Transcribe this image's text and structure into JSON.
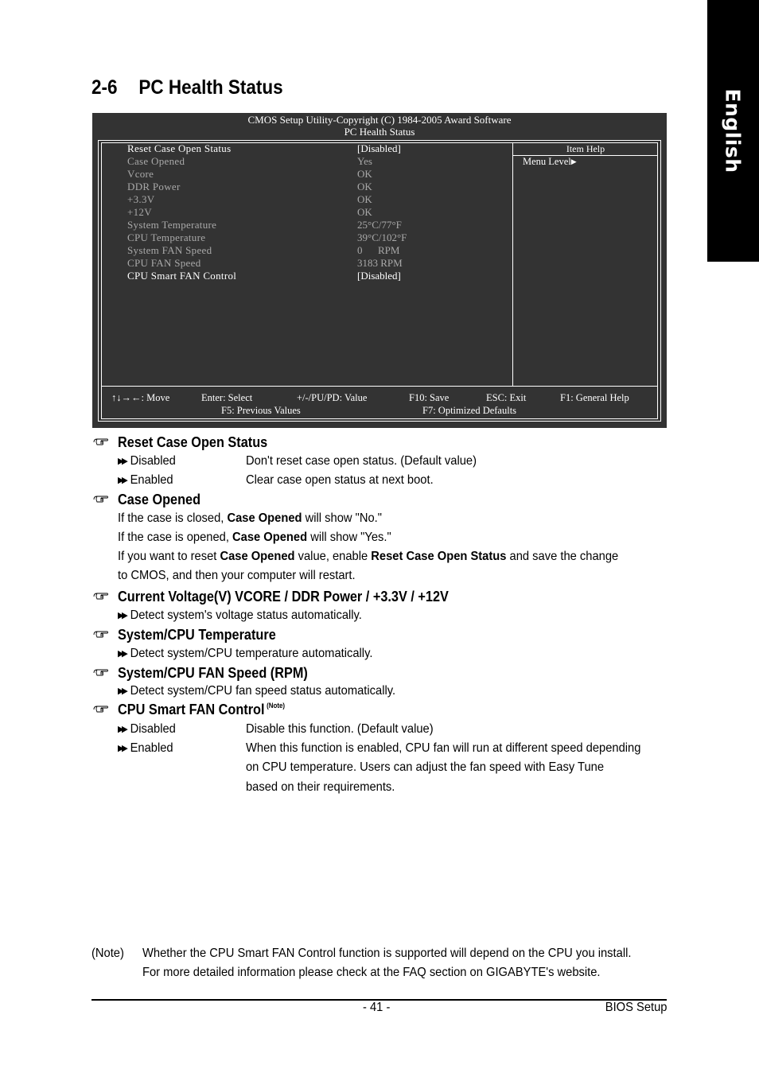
{
  "side_tab": {
    "label": "English"
  },
  "page": {
    "section_number": "2-6",
    "title": "PC Health Status"
  },
  "bios": {
    "header_line1": "CMOS Setup Utility-Copyright (C) 1984-2005 Award Software",
    "header_line2": "PC Health Status",
    "rows": [
      {
        "label": "Reset Case Open Status",
        "value": "[Disabled]",
        "state": "active"
      },
      {
        "label": "Case Opened",
        "value": "Yes",
        "state": "dim"
      },
      {
        "label": "Vcore",
        "value": "OK",
        "state": "dim"
      },
      {
        "label": "DDR Power",
        "value": "OK",
        "state": "dim"
      },
      {
        "label": "+3.3V",
        "value": "OK",
        "state": "dim"
      },
      {
        "label": "+12V",
        "value": "OK",
        "state": "dim"
      },
      {
        "label": "System Temperature",
        "value": "25°C/77°F",
        "state": "dim"
      },
      {
        "label": "CPU Temperature",
        "value": "39°C/102°F",
        "state": "dim"
      },
      {
        "label": "System FAN Speed",
        "value": "0      RPM",
        "state": "dim"
      },
      {
        "label": "CPU FAN Speed",
        "value": "3183 RPM",
        "state": "dim"
      },
      {
        "label": "CPU Smart FAN Control",
        "value": "[Disabled]",
        "state": "active"
      }
    ],
    "help": {
      "title": "Item Help",
      "menu_level": "Menu Level",
      "menu_level_icon": "right-triangle-icon"
    },
    "keys_row1": [
      "↑↓→←: Move",
      "Enter: Select",
      "+/-/PU/PD: Value",
      "F10: Save",
      "ESC: Exit",
      "F1: General Help"
    ],
    "keys_row2": [
      "F5: Previous Values",
      "F7: Optimized Defaults"
    ]
  },
  "sections": {
    "reset_case": {
      "heading": "Reset Case Open Status",
      "options": [
        {
          "name": "Disabled",
          "desc": "Don't reset case open status. (Default value)"
        },
        {
          "name": "Enabled",
          "desc": "Clear case open status at next boot."
        }
      ]
    },
    "case_opened": {
      "heading": "Case Opened",
      "line1_a": "If the case is closed, ",
      "line1_b": "Case Opened",
      "line1_c": " will show \"No.\"",
      "line2_a": "If the case is opened, ",
      "line2_b": "Case Opened",
      "line2_c": " will show \"Yes.\"",
      "line3_a": "If you want to reset ",
      "line3_b": "Case Opened",
      "line3_c": " value, enable ",
      "line3_d": "Reset Case Open Status",
      "line3_e": " and save the change",
      "line4": "to CMOS, and then your computer will restart."
    },
    "voltage": {
      "heading": "Current Voltage(V) VCORE / DDR Power / +3.3V / +12V",
      "desc": "Detect system's voltage status automatically."
    },
    "temperature": {
      "heading": "System/CPU Temperature",
      "desc": "Detect system/CPU temperature automatically."
    },
    "fan_speed": {
      "heading": "System/CPU FAN Speed (RPM)",
      "desc": "Detect system/CPU fan speed status automatically."
    },
    "smart_fan": {
      "heading": "CPU Smart FAN Control",
      "note_mark": "(Note)",
      "options": [
        {
          "name": "Disabled",
          "desc": "Disable this function. (Default value)"
        },
        {
          "name": "Enabled",
          "desc": "When this function is enabled, CPU fan will run at different speed depending"
        }
      ],
      "enabled_cont1": "on CPU temperature. Users can adjust the fan speed with Easy Tune",
      "enabled_cont2": "based on their requirements."
    }
  },
  "note": {
    "label": "(Note)",
    "line1": "Whether the CPU Smart FAN Control function is supported will depend on the CPU you install.",
    "line2": "For more detailed information please check at the FAQ section on GIGABYTE's website."
  },
  "footer": {
    "page_number": "- 41 -",
    "section": "BIOS Setup"
  }
}
